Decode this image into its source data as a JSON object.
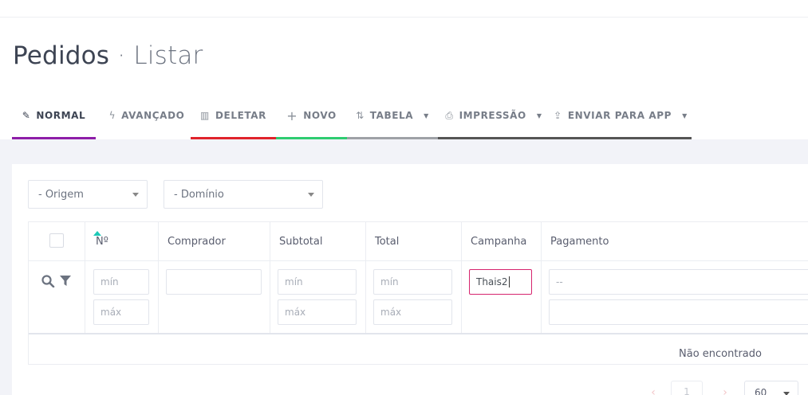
{
  "header": {
    "title_main": "Pedidos",
    "title_sep": "·",
    "title_sub": "Listar"
  },
  "tabs": [
    {
      "label": "NORMAL",
      "icon": "edit-icon",
      "glyph": "✎",
      "underline_color": "#8e1ea8",
      "active": true
    },
    {
      "label": "AVANÇADO",
      "icon": "lightning-icon",
      "glyph": "ϟ",
      "underline_color": "",
      "active": false
    },
    {
      "label": "DELETAR",
      "icon": "trash-icon",
      "glyph": "🗑",
      "underline_color": "#e0232b",
      "active": false
    },
    {
      "label": "NOVO",
      "icon": "plus-icon",
      "glyph": "+",
      "underline_color": "#2ecc71",
      "active": false
    },
    {
      "label": "TABELA",
      "icon": "sort-icon",
      "glyph": "⇅",
      "underline_color": "#9ea1a6",
      "active": false
    },
    {
      "label": "IMPRESSÃO",
      "icon": "printer-icon",
      "glyph": "⎙",
      "underline_color": "#555555",
      "active": false
    },
    {
      "label": "ENVIAR PARA APP",
      "icon": "share-icon",
      "glyph": "⇪",
      "underline_color": "#555555",
      "active": false
    }
  ],
  "filters": {
    "origem": "- Origem",
    "dominio": "- Domínio"
  },
  "table": {
    "columns": [
      "Nº",
      "Comprador",
      "Subtotal",
      "Total",
      "Campanha",
      "Pagamento"
    ],
    "filter_row": {
      "numero_min": "mín",
      "numero_max": "máx",
      "subtotal_min": "mín",
      "subtotal_max": "máx",
      "total_min": "mín",
      "total_max": "máx",
      "campanha_value": "Thais2",
      "pagamento_placeholder": "--"
    },
    "empty_message": "Não encontrado"
  },
  "pagination": {
    "prev": "‹",
    "page": "1",
    "next": "›",
    "page_size": "60"
  },
  "colors": {
    "accent_pink": "#d6246e",
    "sort_indicator": "#1dc9b7"
  }
}
